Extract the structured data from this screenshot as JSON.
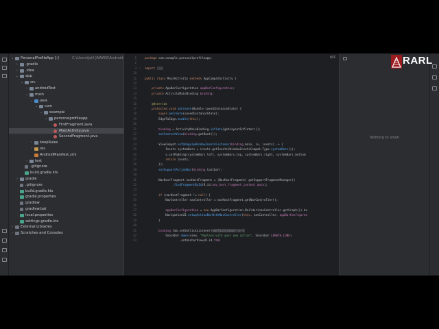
{
  "editor": {
    "notification": "OFF"
  },
  "project_tree": [
    {
      "label": "PersonalProfileApp [:]",
      "path": "C:\\Users\\Jalil JAWADI\\AndroidStudio",
      "icon": "folder",
      "indent": 0,
      "expanded": true
    },
    {
      "label": ".gradle",
      "icon": "folder",
      "indent": 1,
      "expanded": false
    },
    {
      "label": ".idea",
      "icon": "folder",
      "indent": 1,
      "expanded": false
    },
    {
      "label": "app",
      "icon": "folder",
      "indent": 1,
      "expanded": true
    },
    {
      "label": "src",
      "icon": "folder",
      "indent": 2,
      "expanded": true
    },
    {
      "label": "androidTest",
      "icon": "folder",
      "indent": 3,
      "expanded": false
    },
    {
      "label": "main",
      "icon": "folder",
      "indent": 3,
      "expanded": true
    },
    {
      "label": "java",
      "icon": "src",
      "indent": 4,
      "expanded": true
    },
    {
      "label": "com",
      "icon": "pkg",
      "indent": 5,
      "expanded": true
    },
    {
      "label": "example",
      "icon": "pkg",
      "indent": 6,
      "expanded": true
    },
    {
      "label": "personalprofileapp",
      "icon": "pkg",
      "indent": 7,
      "expanded": true
    },
    {
      "label": "FirstFragment.java",
      "icon": "java",
      "indent": 8
    },
    {
      "label": "MainActivity.java",
      "icon": "java",
      "indent": 8,
      "selected": true
    },
    {
      "label": "SecondFragment.java",
      "icon": "java",
      "indent": 8
    },
    {
      "label": "keepRules",
      "icon": "folder",
      "indent": 4,
      "expanded": false
    },
    {
      "label": "res",
      "icon": "res",
      "indent": 4,
      "expanded": false
    },
    {
      "label": "AndroidManifest.xml",
      "icon": "xml",
      "indent": 4
    },
    {
      "label": "test",
      "icon": "folder",
      "indent": 3,
      "expanded": false
    },
    {
      "label": ".gitignore",
      "icon": "file",
      "indent": 2
    },
    {
      "label": "build.gradle.kts",
      "icon": "gradle",
      "indent": 2
    },
    {
      "label": "gradle",
      "icon": "folder",
      "indent": 1,
      "expanded": false
    },
    {
      "label": ".gitignore",
      "icon": "file",
      "indent": 1
    },
    {
      "label": "build.gradle.kts",
      "icon": "gradle",
      "indent": 1
    },
    {
      "label": "gradle.properties",
      "icon": "gradle",
      "indent": 1
    },
    {
      "label": "gradlew",
      "icon": "file",
      "indent": 1
    },
    {
      "label": "gradlew.bat",
      "icon": "file",
      "indent": 1
    },
    {
      "label": "local.properties",
      "icon": "gradle",
      "indent": 1
    },
    {
      "label": "settings.gradle.kts",
      "icon": "gradle",
      "indent": 1
    },
    {
      "label": "External Libraries",
      "icon": "lib",
      "indent": 0,
      "expanded": false
    },
    {
      "label": "Scratches and Consoles",
      "icon": "lib",
      "indent": 0,
      "expanded": false
    }
  ],
  "code_lines": [
    {
      "n": "1",
      "t": [
        [
          "k",
          "package "
        ],
        [
          "ty",
          "com.example.personalprofileapp;"
        ]
      ]
    },
    {
      "n": "2",
      "t": []
    },
    {
      "n": "3",
      "t": [
        [
          "k",
          "import "
        ],
        [
          "hint",
          "..."
        ]
      ]
    },
    {
      "n": "10",
      "t": []
    },
    {
      "n": "11",
      "t": [
        [
          "k",
          "public class "
        ],
        [
          "ty",
          "MainActivity "
        ],
        [
          "k",
          "extends "
        ],
        [
          "ty",
          "AppCompatActivity {"
        ]
      ]
    },
    {
      "n": "12",
      "t": []
    },
    {
      "n": "13",
      "t": [
        [
          "k",
          "    private "
        ],
        [
          "ty",
          "AppBarConfiguration "
        ],
        [
          "fi",
          "appBarConfiguration"
        ],
        [
          "ty",
          ";"
        ]
      ]
    },
    {
      "n": "14",
      "t": [
        [
          "k",
          "    private "
        ],
        [
          "ty",
          "ActivityMainBinding "
        ],
        [
          "fi",
          "binding"
        ],
        [
          "ty",
          ";"
        ]
      ]
    },
    {
      "n": "15",
      "t": []
    },
    {
      "n": "16",
      "t": [
        [
          "an",
          "    @Override"
        ]
      ]
    },
    {
      "n": "17",
      "t": [
        [
          "k",
          "    protected void "
        ],
        [
          "fn",
          "onCreate"
        ],
        [
          "ty",
          "(Bundle savedInstanceState) {"
        ]
      ]
    },
    {
      "n": "18",
      "t": [
        [
          "k",
          "        super"
        ],
        [
          "ty",
          "."
        ],
        [
          "fn",
          "onCreate"
        ],
        [
          "ty",
          "(savedInstanceState);"
        ]
      ]
    },
    {
      "n": "19",
      "t": [
        [
          "ty",
          "        EdgeToEdge."
        ],
        [
          "fn",
          "enable"
        ],
        [
          "ty",
          "("
        ],
        [
          "k",
          "this"
        ],
        [
          "ty",
          ");"
        ]
      ]
    },
    {
      "n": "20",
      "t": []
    },
    {
      "n": "21",
      "t": [
        [
          "fi",
          "        binding "
        ],
        [
          "ty",
          "= ActivityMainBinding."
        ],
        [
          "fn",
          "inflate"
        ],
        [
          "ty",
          "(getLayoutInflater());"
        ]
      ]
    },
    {
      "n": "22",
      "t": [
        [
          "fn",
          "        setContentView"
        ],
        [
          "ty",
          "("
        ],
        [
          "fi",
          "binding"
        ],
        [
          "ty",
          ".getRoot());"
        ]
      ]
    },
    {
      "n": "23",
      "t": []
    },
    {
      "n": "24",
      "t": [
        [
          "ty",
          "        ViewCompat."
        ],
        [
          "fn",
          "setOnApplyWindowInsetsListener"
        ],
        [
          "ty",
          "("
        ],
        [
          "fi",
          "binding"
        ],
        [
          "ty",
          ".main, (v, insets) -> {"
        ]
      ]
    },
    {
      "n": "25",
      "t": [
        [
          "ty",
          "            Insets systemBars = insets.getInsets(WindowInsetsCompat.Type."
        ],
        [
          "fn",
          "systemBars"
        ],
        [
          "ty",
          "());"
        ]
      ]
    },
    {
      "n": "26",
      "t": [
        [
          "ty",
          "            v.setPadding(systemBars.left, systemBars.top, systemBars.right, systemBars.bottom"
        ]
      ]
    },
    {
      "n": "27",
      "t": [
        [
          "k",
          "            return "
        ],
        [
          "ty",
          "insets;"
        ]
      ]
    },
    {
      "n": "28",
      "t": [
        [
          "ty",
          "        });"
        ]
      ]
    },
    {
      "n": "29",
      "t": [
        [
          "fn",
          "        setSupportActionBar"
        ],
        [
          "ty",
          "("
        ],
        [
          "fi",
          "binding"
        ],
        [
          "ty",
          ".toolbar);"
        ]
      ]
    },
    {
      "n": "30",
      "t": []
    },
    {
      "n": "31",
      "t": [
        [
          "ty",
          "        NavHostFragment navHostFragment = (NavHostFragment) getSupportFragmentManager()"
        ]
      ]
    },
    {
      "n": "32",
      "t": [
        [
          "ty",
          "                ."
        ],
        [
          "fn",
          "findFragmentById"
        ],
        [
          "ty",
          "(R.id."
        ],
        [
          "fi",
          "nav_host_fragment_content_main"
        ],
        [
          "ty",
          ");"
        ]
      ]
    },
    {
      "n": "33",
      "t": []
    },
    {
      "n": "34",
      "t": [
        [
          "k",
          "        if "
        ],
        [
          "ty",
          "(navHostFragment != "
        ],
        [
          "k",
          "null"
        ],
        [
          "ty",
          ") {"
        ]
      ]
    },
    {
      "n": "35",
      "t": [
        [
          "ty",
          "            NavController navController = navHostFragment.getNavController();"
        ]
      ]
    },
    {
      "n": "36",
      "t": []
    },
    {
      "n": "37",
      "t": [
        [
          "fi",
          "            appBarConfiguration "
        ],
        [
          "ty",
          "= "
        ],
        [
          "k",
          "new "
        ],
        [
          "ty",
          "AppBarConfiguration.Builder(navController.getGraph()).bu"
        ]
      ]
    },
    {
      "n": "38",
      "t": [
        [
          "ty",
          "            NavigationUI."
        ],
        [
          "fn",
          "setupActionBarWithNavController"
        ],
        [
          "ty",
          "("
        ],
        [
          "k",
          "this"
        ],
        [
          "ty",
          ", navController, "
        ],
        [
          "fi",
          "appBarConfigurat"
        ]
      ]
    },
    {
      "n": "39",
      "t": [
        [
          "ty",
          "        }"
        ]
      ]
    },
    {
      "n": "40",
      "t": []
    },
    {
      "n": "41",
      "t": [
        [
          "fi",
          "        binding"
        ],
        [
          "ty",
          ".fab.setOnClickListener("
        ],
        [
          "hint",
          "onClick(view) -> {"
        ]
      ]
    },
    {
      "n": "42",
      "t": [
        [
          "ty",
          "            Snackbar."
        ],
        [
          "fn",
          "make"
        ],
        [
          "ty",
          "(view, "
        ],
        [
          "st",
          "\"Replace with your own action\""
        ],
        [
          "ty",
          ", Snackbar."
        ],
        [
          "fi",
          "LENGTH_LONG"
        ],
        [
          "ty",
          ")"
        ]
      ]
    },
    {
      "n": "43",
      "t": [
        [
          "ty",
          "                    .setAnchorView(R.id."
        ],
        [
          "fi",
          "fab"
        ],
        [
          "ty",
          ")"
        ]
      ]
    }
  ],
  "right_panel": {
    "empty_text": "Nothing to show"
  },
  "watermark": {
    "text": "RARL"
  }
}
